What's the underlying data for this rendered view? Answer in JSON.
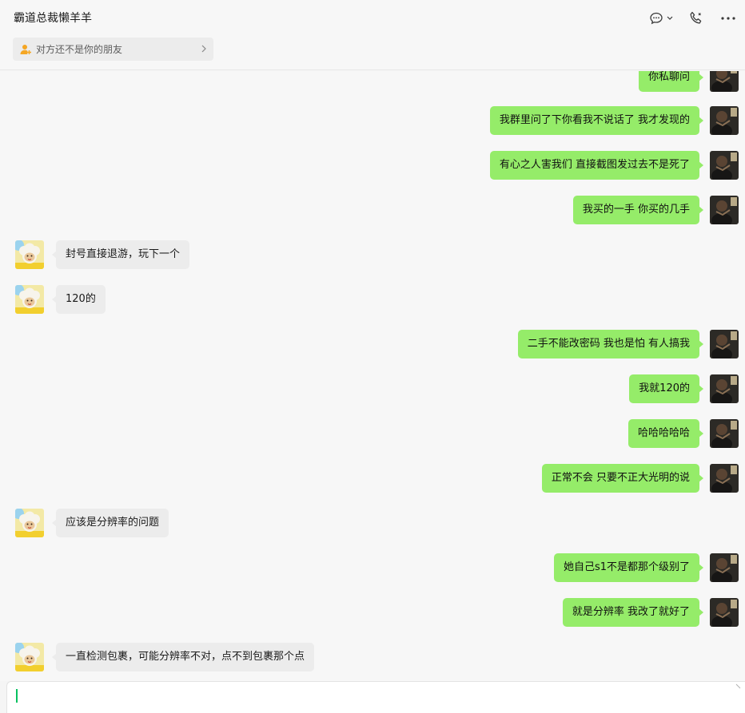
{
  "header": {
    "title": "霸道总裁懒羊羊",
    "actions": {
      "chat": "chat-bubble-icon",
      "call": "phone-icon",
      "more": "more-icon"
    }
  },
  "notice": {
    "text": "对方还不是你的朋友",
    "icon": "add-contact-icon"
  },
  "colors": {
    "sent_bubble": "#95ec69",
    "received_bubble": "#ececec",
    "caret": "#07c160",
    "notice_icon": "#f5a623"
  },
  "messages": [
    {
      "side": "right",
      "text": "你私聊问"
    },
    {
      "side": "right",
      "text": "我群里问了下你看我不说话了  我才发现的"
    },
    {
      "side": "right",
      "text": "有心之人害我们  直接截图发过去不是死了"
    },
    {
      "side": "right",
      "text": "我买的一手 你买的几手"
    },
    {
      "side": "left",
      "text": "封号直接退游，玩下一个"
    },
    {
      "side": "left",
      "text": "120的"
    },
    {
      "side": "right",
      "text": "二手不能改密码 我也是怕 有人搞我"
    },
    {
      "side": "right",
      "text": "我就120的"
    },
    {
      "side": "right",
      "text": "哈哈哈哈哈"
    },
    {
      "side": "right",
      "text": "正常不会  只要不正大光明的说"
    },
    {
      "side": "left",
      "text": "应该是分辨率的问题"
    },
    {
      "side": "right",
      "text": "她自己s1不是都那个级别了"
    },
    {
      "side": "right",
      "text": "就是分辨率 我改了就好了"
    },
    {
      "side": "left",
      "text": "一直检测包裹，可能分辨率不对，点不到包裹那个点"
    }
  ],
  "input": {
    "value": ""
  }
}
